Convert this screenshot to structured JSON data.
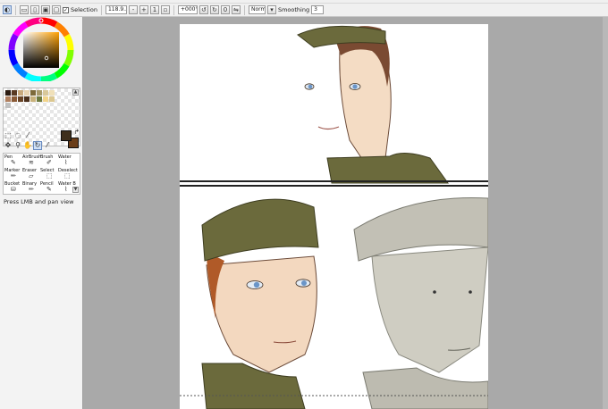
{
  "toolbar": {
    "selection_label": "Selection",
    "zoom_value": "118.9...",
    "angle_value": "+000°",
    "blend_mode": "Normal",
    "smoothing_label": "Smoothing",
    "smoothing_value": "3",
    "selection_checked": true
  },
  "palette": {
    "colors": [
      "#2b1a10",
      "#5a3a22",
      "#c8a87c",
      "#e8d2b0",
      "#7d6a3a",
      "#a89a6a",
      "#d9c89a",
      "#f0e0b8",
      "#b08060",
      "#8a5a36",
      "#6a4426",
      "#4a2e1a",
      "#c9b27c",
      "#6e7a3e",
      "#f2d48a",
      "#dcc890",
      "#c0c0c0"
    ]
  },
  "brushes": [
    {
      "label": "Pen",
      "icon": "pen-icon"
    },
    {
      "label": "AirBrush",
      "icon": "airbrush-icon"
    },
    {
      "label": "Brush",
      "icon": "brush-icon"
    },
    {
      "label": "Water",
      "icon": "water-icon"
    },
    {
      "label": "Marker",
      "icon": "marker-icon"
    },
    {
      "label": "Eraser",
      "icon": "eraser-icon"
    },
    {
      "label": "Select",
      "icon": "select-icon"
    },
    {
      "label": "Deselect",
      "icon": "deselect-icon"
    },
    {
      "label": "Bucket",
      "icon": "bucket-icon"
    },
    {
      "label": "Binary",
      "icon": "binary-icon"
    },
    {
      "label": "Pencil",
      "icon": "pencil-icon"
    },
    {
      "label": "Water B",
      "icon": "water-b-icon"
    }
  ],
  "status": {
    "text": "Press LMB and pan view"
  },
  "colors": {
    "foreground": "#3e2f1c",
    "background": "#6a3d18",
    "workspace": "#a9a9a9",
    "uniform_green": "#6b6a3c"
  }
}
